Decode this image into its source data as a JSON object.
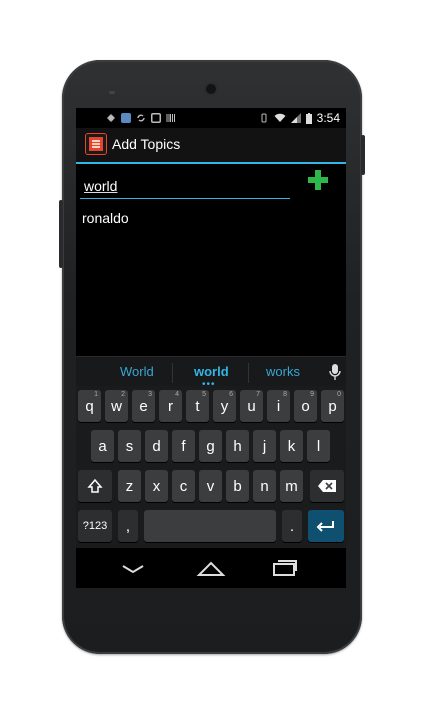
{
  "statusbar": {
    "time": "3:54"
  },
  "actionbar": {
    "title": "Add Topics",
    "app_icon": "list-icon"
  },
  "form": {
    "topic_value": "world"
  },
  "topics": [
    "ronaldo"
  ],
  "suggestions": {
    "left": "World",
    "middle": "world",
    "right": "works",
    "more_indicator": "•••"
  },
  "keyboard": {
    "row1": [
      {
        "label": "q",
        "hint": "1"
      },
      {
        "label": "w",
        "hint": "2"
      },
      {
        "label": "e",
        "hint": "3"
      },
      {
        "label": "r",
        "hint": "4"
      },
      {
        "label": "t",
        "hint": "5"
      },
      {
        "label": "y",
        "hint": "6"
      },
      {
        "label": "u",
        "hint": "7"
      },
      {
        "label": "i",
        "hint": "8"
      },
      {
        "label": "o",
        "hint": "9"
      },
      {
        "label": "p",
        "hint": "0"
      }
    ],
    "row2": [
      "a",
      "s",
      "d",
      "f",
      "g",
      "h",
      "j",
      "k",
      "l"
    ],
    "row3": [
      "z",
      "x",
      "c",
      "v",
      "b",
      "n",
      "m"
    ],
    "symbols_label": "?123",
    "comma_label": ",",
    "period_label": "."
  },
  "colors": {
    "accent": "#33b5e5",
    "add_button": "#2db84b",
    "app_icon": "#e8442c"
  }
}
